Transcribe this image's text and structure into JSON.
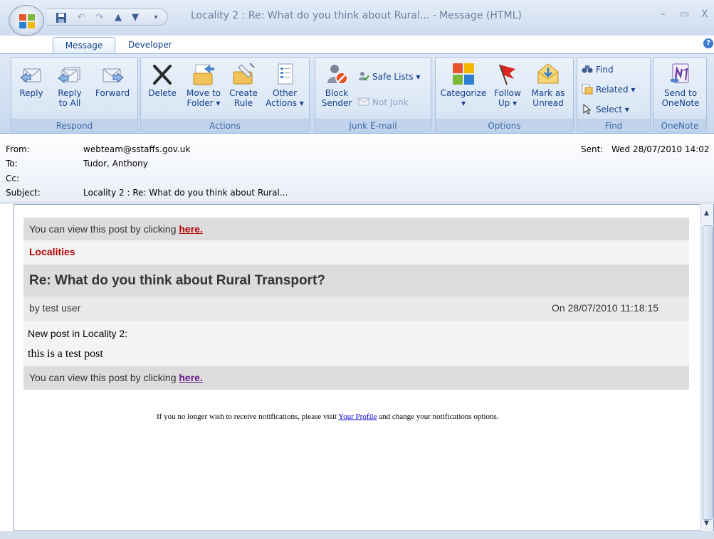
{
  "window": {
    "title": "Locality 2 : Re: What do you think about Rural... - Message (HTML)",
    "minimize": "–",
    "restore": "▭",
    "close": "X"
  },
  "tabs": [
    {
      "label": "Message",
      "active": true
    },
    {
      "label": "Developer",
      "active": false
    }
  ],
  "ribbon": {
    "respond": {
      "label": "Respond",
      "reply": "Reply",
      "reply_all_1": "Reply",
      "reply_all_2": "to All",
      "forward": "Forward"
    },
    "actions": {
      "label": "Actions",
      "delete": "Delete",
      "move_1": "Move to",
      "move_2": "Folder ▾",
      "create_1": "Create",
      "create_2": "Rule",
      "other_1": "Other",
      "other_2": "Actions ▾"
    },
    "junk": {
      "label": "Junk E-mail",
      "block_1": "Block",
      "block_2": "Sender",
      "safe_lists": "Safe Lists ▾",
      "not_junk": "Not Junk"
    },
    "options": {
      "label": "Options",
      "categorize": "Categorize",
      "categorize_arrow": "▾",
      "follow_1": "Follow",
      "follow_2": "Up ▾",
      "mark_1": "Mark as",
      "mark_2": "Unread"
    },
    "find": {
      "label": "Find",
      "find": "Find",
      "related": "Related ▾",
      "select": "Select ▾"
    },
    "onenote": {
      "label": "OneNote",
      "send_1": "Send to",
      "send_2": "OneNote"
    }
  },
  "header": {
    "from_label": "From:",
    "from_value": "webteam@sstaffs.gov.uk",
    "to_label": "To:",
    "to_value": "Tudor, Anthony",
    "cc_label": "Cc:",
    "subject_label": "Subject:",
    "subject_value": "Locality 2 : Re: What do you think about Rural...",
    "sent_label": "Sent:",
    "sent_value": "Wed 28/07/2010 14:02"
  },
  "message": {
    "view_prefix": "You can view this post by clicking ",
    "view_link": "here.",
    "category": "Localities",
    "post_title": "Re: What do you think about Rural Transport?",
    "author": "by test user",
    "posted_on": "On 28/07/2010 11:18:15",
    "intro": "New post in Locality 2:",
    "content": "this is a test post",
    "footer_prefix": "If you no longer wish to receive notifications, please visit ",
    "footer_link": "Your Profile",
    "footer_suffix": " and change your notifications options."
  },
  "colors": {
    "ribbon_text": "#15428b",
    "link_red": "#b30000",
    "link_visited": "#6b1c8a",
    "band_grey": "#dcdcdc"
  }
}
